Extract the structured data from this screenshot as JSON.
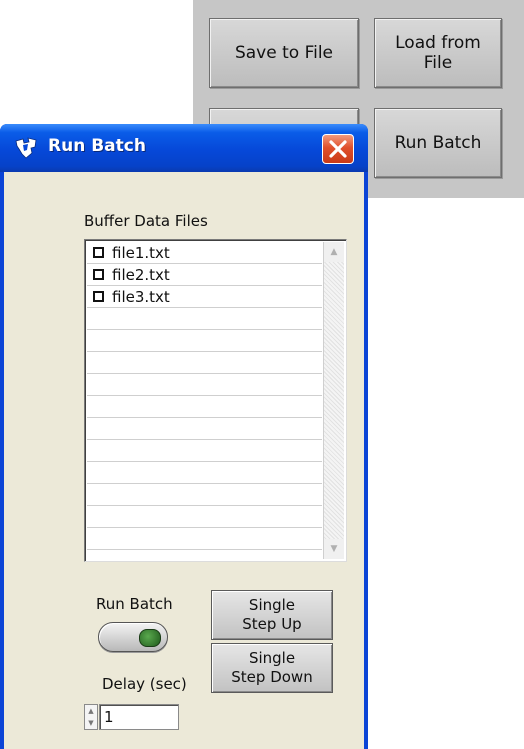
{
  "background_panel": {
    "buttons": [
      {
        "id": "save",
        "label": "Save to File"
      },
      {
        "id": "load",
        "label": "Load from\nFile"
      },
      {
        "id": "hidden",
        "label": ""
      },
      {
        "id": "run",
        "label": "Run Batch"
      }
    ]
  },
  "dialog": {
    "title": "Run Batch",
    "app_icon": "ti-logo-icon",
    "close_icon": "close-icon",
    "buffer_label": "Buffer Data Files",
    "files": [
      {
        "name": "file1.txt",
        "checked": false
      },
      {
        "name": "file2.txt",
        "checked": false
      },
      {
        "name": "file3.txt",
        "checked": false
      }
    ],
    "empty_rows": 11,
    "run_batch_label": "Run Batch",
    "single_step_up": "Single\nStep Up",
    "single_step_down": "Single\nStep Down",
    "delay_label": "Delay (sec)",
    "delay_value": "1"
  },
  "colors": {
    "titlebar": "#0648d8",
    "client_bg": "#ece9d8",
    "close_button": "#e0502c",
    "panel_bg": "#c6c6c6",
    "toggle_led": "#3f8a36"
  }
}
